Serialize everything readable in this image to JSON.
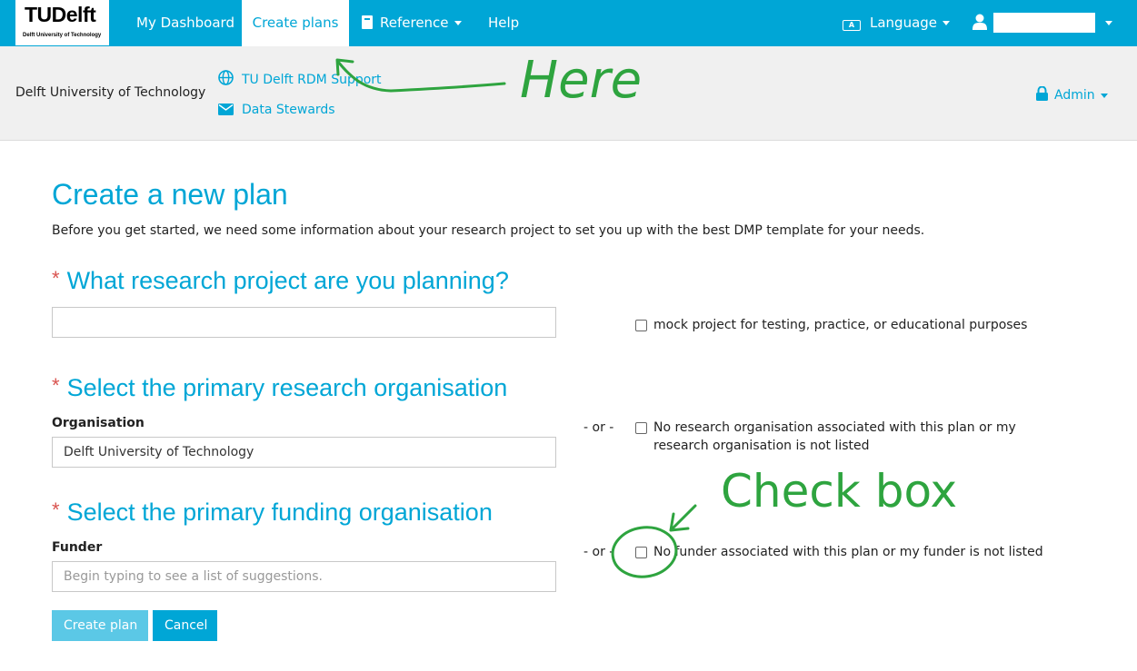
{
  "nav": {
    "logo": "TUDelft",
    "logo_sub": "Delft University of Technology",
    "dashboard": "My Dashboard",
    "create_plans": "Create plans",
    "reference": "Reference",
    "help": "Help",
    "language": "Language"
  },
  "subheader": {
    "org_name": "Delft University of Technology",
    "rdm_support": "TU Delft RDM Support",
    "data_stewards": "Data Stewards",
    "admin": "Admin"
  },
  "page": {
    "title": "Create a new plan",
    "intro": "Before you get started, we need some information about your research project to set you up with the best DMP template for your needs."
  },
  "project": {
    "heading": "What research project are you planning?",
    "value": "",
    "mock_label": "mock project for testing, practice, or educational purposes"
  },
  "organisation": {
    "heading": "Select the primary research organisation",
    "label": "Organisation",
    "value": "Delft University of Technology",
    "or": "- or -",
    "none_label": "No research organisation associated with this plan or my research organisation is not listed"
  },
  "funder": {
    "heading": "Select the primary funding organisation",
    "label": "Funder",
    "placeholder": "Begin typing to see a list of suggestions.",
    "or": "- or -",
    "none_label": "No funder associated with this plan or my funder is not listed"
  },
  "buttons": {
    "create": "Create plan",
    "cancel": "Cancel"
  },
  "annotations": {
    "here": "Here",
    "check_box": "Check box"
  },
  "colors": {
    "brand": "#00a6d6",
    "annotation": "#2ea43f",
    "required": "#d9534f"
  }
}
